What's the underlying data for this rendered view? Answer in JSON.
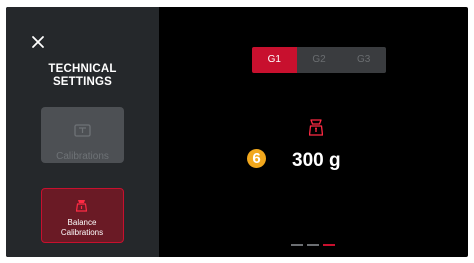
{
  "sidebar": {
    "title_line1": "TECHNICAL",
    "title_line2": "SETTINGS",
    "close_icon": "close-icon",
    "tiles": [
      {
        "label": "Calibrations",
        "icon": "scale-flat-icon",
        "state": "disabled"
      },
      {
        "label_line1": "Balance",
        "label_line2": "Calibrations",
        "icon": "scale-icon",
        "state": "selected"
      }
    ]
  },
  "group_selector": {
    "options": [
      "G1",
      "G2",
      "G3"
    ],
    "selected": "G1"
  },
  "main": {
    "icon": "scale-icon",
    "step_badge": "6",
    "weight": "300 g"
  },
  "pager": {
    "pages": 3,
    "current": 3
  },
  "colors": {
    "accent": "#c8102e",
    "badge": "#f2a81d",
    "sidebar_bg": "#25282b",
    "content_bg": "#000000"
  }
}
